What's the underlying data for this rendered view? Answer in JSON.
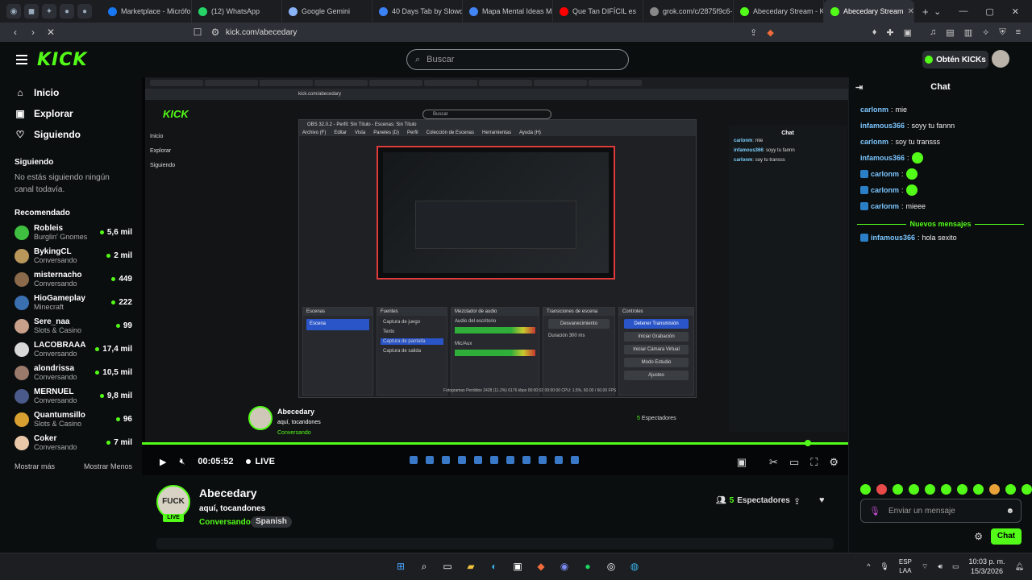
{
  "browser": {
    "tabs": [
      {
        "label": "Marketplace - Micrófo",
        "color": "#1877f2"
      },
      {
        "label": "(12) WhatsApp",
        "color": "#25d366"
      },
      {
        "label": "Google Gemini",
        "color": "#8ab4f8"
      },
      {
        "label": "40 Days Tab by Slowdi",
        "color": "#3b82f6"
      },
      {
        "label": "Mapa Mental Ideas Mi",
        "color": "#4285f4"
      },
      {
        "label": "Que Tan DIFÍCIL es",
        "color": "#ff0000"
      },
      {
        "label": "grok.com/c/2875f9c6-",
        "color": "#888888"
      },
      {
        "label": "Abecedary Stream - K",
        "color": "#53fc18"
      },
      {
        "label": "Abecedary Stream",
        "color": "#53fc18",
        "active": true
      }
    ],
    "url": "kick.com/abecedary",
    "new_tab": "+"
  },
  "header": {
    "logo": "KICK",
    "search_placeholder": "Buscar",
    "kicks_button": "Obtén KICKs"
  },
  "sidebar": {
    "nav": [
      {
        "label": "Inicio",
        "icon": "home-icon",
        "glyph": "⌂"
      },
      {
        "label": "Explorar",
        "icon": "browse-icon",
        "glyph": "▣"
      },
      {
        "label": "Siguiendo",
        "icon": "heart-icon",
        "glyph": "♡"
      }
    ],
    "following_title": "Siguiendo",
    "following_empty": "No estás siguiendo ningún canal todavía.",
    "recommended_title": "Recomendado",
    "recommended": [
      {
        "name": "Robleis",
        "category": "Burglin' Gnomes",
        "viewers": "5,6 mil",
        "color": "#3fbf3f"
      },
      {
        "name": "BykingCL",
        "category": "Conversando",
        "viewers": "2 mil",
        "color": "#b9975b"
      },
      {
        "name": "misternacho",
        "category": "Conversando",
        "viewers": "449",
        "color": "#8a6a4a"
      },
      {
        "name": "HioGameplay",
        "category": "Minecraft",
        "viewers": "222",
        "color": "#3a6fb0"
      },
      {
        "name": "Sere_naa",
        "category": "Slots & Casino",
        "viewers": "99",
        "color": "#c9a08a"
      },
      {
        "name": "LACOBRAAA",
        "category": "Conversando",
        "viewers": "17,4 mil",
        "color": "#d8d8d8"
      },
      {
        "name": "alondrissa",
        "category": "Conversando",
        "viewers": "10,5 mil",
        "color": "#9a7a6a"
      },
      {
        "name": "MERNUEL",
        "category": "Conversando",
        "viewers": "9,8 mil",
        "color": "#4a5a8a"
      },
      {
        "name": "Quantumsillo",
        "category": "Slots & Casino",
        "viewers": "96",
        "color": "#d8a030"
      },
      {
        "name": "Coker",
        "category": "Conversando",
        "viewers": "7 mil",
        "color": "#e8c8a8"
      }
    ],
    "show_more": "Mostrar más",
    "show_less": "Mostrar Menos"
  },
  "player": {
    "time": "00:05:52",
    "live": "LIVE",
    "nested": {
      "obs_title": "OBS 32.0.2 - Perfil: Sin Título - Escenas: Sin Título",
      "obs_menu": [
        "Archivo (F)",
        "Editar",
        "Vista",
        "Paneles (D)",
        "Perfil",
        "Colección de Escenas",
        "Herramientas",
        "Ayuda (H)"
      ],
      "docks": [
        "Escenas",
        "Fuentes",
        "Mezclador de audio",
        "Transiciones de escena",
        "Controles"
      ],
      "scene": "Escena",
      "sources": [
        "Captura de juego",
        "Texto",
        "Captura de pantalla",
        "Captura de salida"
      ],
      "mixer": [
        "Audio del escritorio",
        "Mic/Aux"
      ],
      "transition": "Desvanecimiento",
      "duration_label": "Duración",
      "duration": "300 ms",
      "controls": [
        "Detener Transmisión",
        "Iniciar Grabación",
        "Iniciar Cámara Virtual",
        "Modo Estudio",
        "Ajustes"
      ],
      "status": "Fotogramas Perdidos 2428 (11.2%)   6176 kbps   00:00:02   00:00:00   CPU: 1.5%, 60.00 / 60.00 FPS"
    }
  },
  "stream": {
    "channel": "Abecedary",
    "title": "aquí, tocandones",
    "category": "Conversando",
    "tag": "Spanish",
    "viewers": "5",
    "viewers_label": "Espectadores",
    "live_badge": "LIVE",
    "avatar_text": "FUCK"
  },
  "chat": {
    "title": "Chat",
    "messages": [
      {
        "user": "carlonm",
        "text": "mie"
      },
      {
        "user": "infamous366",
        "text": "soyy tu fannn"
      },
      {
        "user": "carlonm",
        "text": "soy tu transss"
      },
      {
        "user": "infamous366",
        "text": "",
        "emote": true
      },
      {
        "user": "carlonm",
        "text": "",
        "emote": true,
        "badge": true
      },
      {
        "user": "carlonm",
        "text": "",
        "emote": true,
        "badge": true
      },
      {
        "user": "carlonm",
        "text": "mieee",
        "badge": true
      }
    ],
    "new_messages": "Nuevos mensajes",
    "after": [
      {
        "user": "infamous366",
        "text": "hola sexito",
        "badge": true
      }
    ],
    "input_placeholder": "Enviar un mensaje",
    "send_button": "Chat"
  },
  "taskbar": {
    "language": "ESP",
    "language2": "LAA",
    "time": "10:03 p. m.",
    "date": "15/3/2026"
  }
}
